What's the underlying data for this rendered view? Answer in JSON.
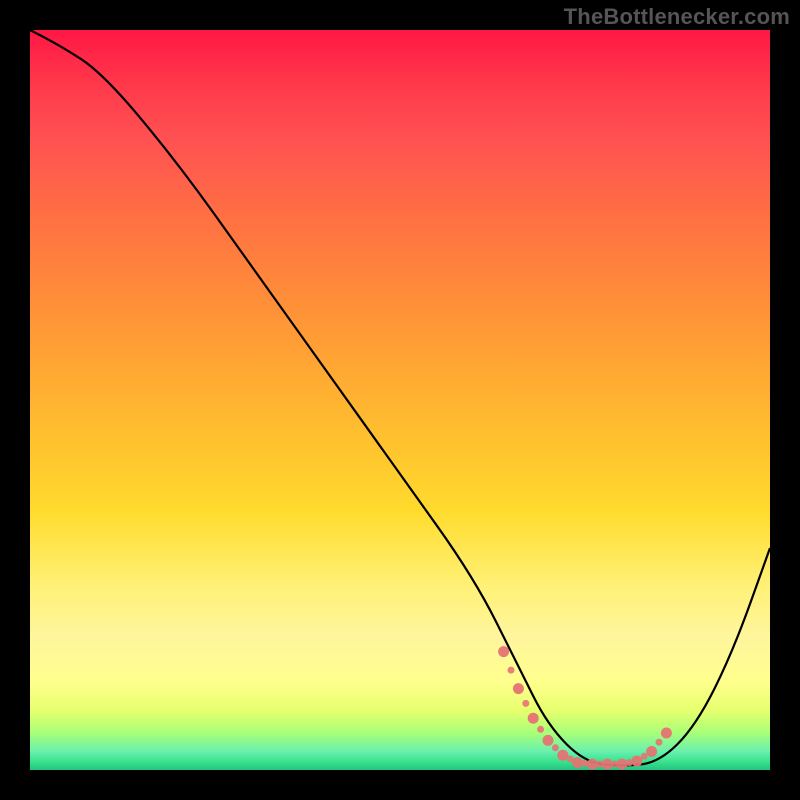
{
  "watermark": "TheBottlenecker.com",
  "chart_data": {
    "type": "line",
    "title": "",
    "xlabel": "",
    "ylabel": "",
    "xlim": [
      0,
      100
    ],
    "ylim": [
      0,
      100
    ],
    "series": [
      {
        "name": "curve",
        "x": [
          0,
          4,
          10,
          20,
          30,
          40,
          50,
          60,
          66,
          70,
          75,
          80,
          85,
          90,
          95,
          100
        ],
        "y": [
          100,
          98,
          94,
          82,
          68,
          54,
          40,
          26,
          14,
          6,
          1,
          0.5,
          1,
          6,
          16,
          30
        ]
      }
    ],
    "highlight_segment": {
      "note": "pink dotted band along the valley",
      "x": [
        64,
        66,
        68,
        70,
        72,
        74,
        76,
        78,
        80,
        82,
        84,
        86
      ],
      "y": [
        16,
        11,
        7,
        4,
        2,
        1,
        0.8,
        0.8,
        0.8,
        1.2,
        2.5,
        5
      ]
    },
    "gradient_stops": [
      {
        "pct": 0,
        "color": "#ff1744"
      },
      {
        "pct": 15,
        "color": "#ff5252"
      },
      {
        "pct": 35,
        "color": "#ff8a3a"
      },
      {
        "pct": 55,
        "color": "#ffc02e"
      },
      {
        "pct": 75,
        "color": "#fff176"
      },
      {
        "pct": 92,
        "color": "#e6ff6e"
      },
      {
        "pct": 97,
        "color": "#69f0ae"
      },
      {
        "pct": 100,
        "color": "#26c281"
      }
    ]
  }
}
